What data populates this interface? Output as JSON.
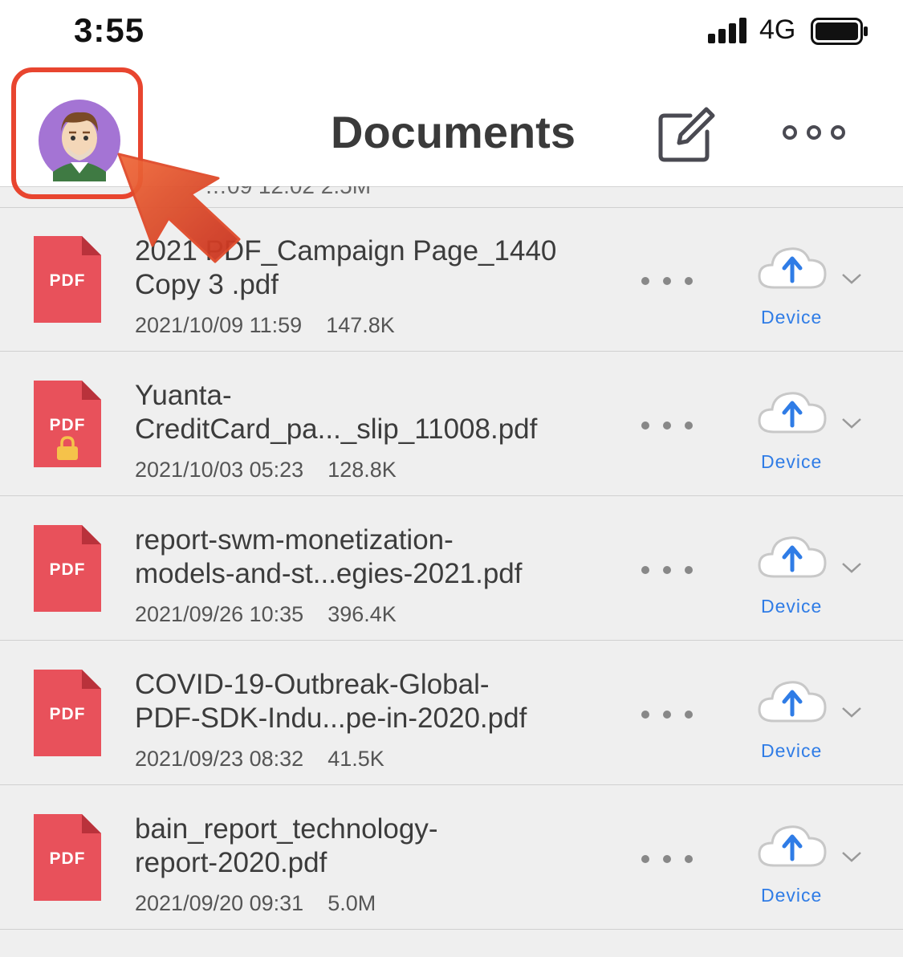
{
  "status_bar": {
    "time": "3:55",
    "network": "4G"
  },
  "nav": {
    "title": "Documents"
  },
  "partial_row": {
    "text": "…09 12:02   2.5M"
  },
  "files": [
    {
      "name": "2021 PDF_Campaign Page_1440\nCopy  3 .pdf",
      "date": "2021/10/09 11:59",
      "size": "147.8K",
      "locked": false,
      "location": "Device"
    },
    {
      "name": "Yuanta-\nCreditCard_pa..._slip_11008.pdf",
      "date": "2021/10/03 05:23",
      "size": "128.8K",
      "locked": true,
      "location": "Device"
    },
    {
      "name": "report-swm-monetization-\nmodels-and-st...egies-2021.pdf",
      "date": "2021/09/26 10:35",
      "size": "396.4K",
      "locked": false,
      "location": "Device"
    },
    {
      "name": "COVID-19-Outbreak-Global-\nPDF-SDK-Indu...pe-in-2020.pdf",
      "date": "2021/09/23 08:32",
      "size": "41.5K",
      "locked": false,
      "location": "Device"
    },
    {
      "name": "bain_report_technology-\nreport-2020.pdf",
      "date": "2021/09/20 09:31",
      "size": "5.0M",
      "locked": false,
      "location": "Device"
    }
  ],
  "pdf_label": "PDF",
  "colors": {
    "accent": "#2f7ce6",
    "pdf": "#e8515b",
    "highlight": "#e8452f"
  }
}
